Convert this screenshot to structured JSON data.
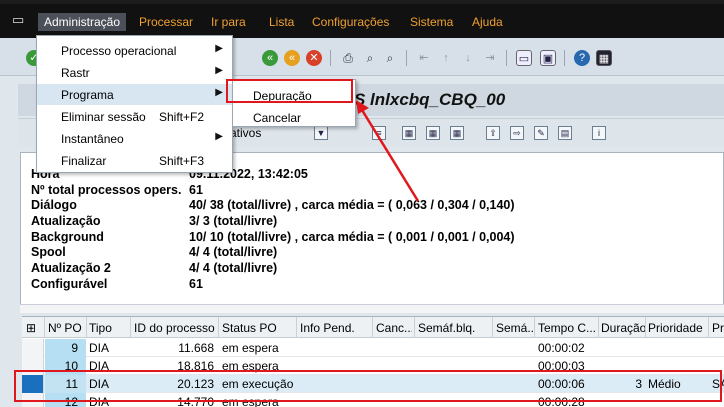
{
  "menubar": {
    "items": [
      "Administração",
      "Processar",
      "Ir para",
      "Lista",
      "Configurações",
      "Sistema",
      "Ajuda"
    ],
    "mnemonics": [
      "A",
      "P",
      "I",
      "L",
      "C",
      "S",
      "A"
    ]
  },
  "dropdown": {
    "items": [
      {
        "label": "Processo operacional",
        "shortcut": "",
        "submenu": true
      },
      {
        "label": "Rastr",
        "shortcut": "",
        "submenu": true
      },
      {
        "label": "Programa",
        "shortcut": "",
        "submenu": true
      },
      {
        "label": "Eliminar sessão",
        "shortcut": "Shift+F2",
        "submenu": false
      },
      {
        "label": "Instantâneo",
        "shortcut": "",
        "submenu": true
      },
      {
        "label": "Finalizar",
        "shortcut": "Shift+F3",
        "submenu": false
      }
    ]
  },
  "submenu": {
    "items": [
      "Depuração",
      "Cancelar"
    ]
  },
  "title": "S lnlxcbq_CBQ_00",
  "app_toolbar": {
    "partial_label": "ativos"
  },
  "info": [
    {
      "label": "Hora",
      "value": "09.11.2022, 13:42:05"
    },
    {
      "label": "Nº total processos opers.",
      "value": "61"
    },
    {
      "label": "Diálogo",
      "value": "40/ 38 (total/livre) , carca média = ( 0,063 / 0,304 / 0,140)"
    },
    {
      "label": "Atualização",
      "value": "3/ 3 (total/livre)"
    },
    {
      "label": "Background",
      "value": "10/ 10 (total/livre) , carca média = ( 0,001 / 0,001 / 0,004)"
    },
    {
      "label": "Spool",
      "value": "4/ 4 (total/livre)"
    },
    {
      "label": "Atualização 2",
      "value": "4/ 4 (total/livre)"
    },
    {
      "label": "Configurável",
      "value": "61"
    }
  ],
  "grid": {
    "columns": [
      "Nº PO",
      "Tipo",
      "ID do processo",
      "Status PO",
      "Info Pend.",
      "Canc...",
      "Semáf.blq.",
      "Semá...",
      "Tempo C...",
      "Duração",
      "Prioridade",
      "Pr"
    ],
    "rows": [
      [
        "9",
        "DIA",
        "11.668",
        "em espera",
        "",
        "",
        "",
        "",
        "00:00:02",
        "",
        "",
        ""
      ],
      [
        "10",
        "DIA",
        "18.816",
        "em espera",
        "",
        "",
        "",
        "",
        "00:00:03",
        "",
        "",
        ""
      ],
      [
        "11",
        "DIA",
        "20.123",
        "em execução",
        "",
        "",
        "",
        "",
        "00:00:06",
        "3",
        "Médio",
        "SA"
      ],
      [
        "12",
        "DIA",
        "14.770",
        "em espera",
        "",
        "",
        "",
        "",
        "00:00:28",
        "",
        "",
        ""
      ]
    ]
  },
  "colors": {
    "accent_menu": "#f0a030",
    "annotation": "#e0181e",
    "selection": "#1a6fbf"
  },
  "icons": [
    "system-menu-icon",
    "check-icon",
    "back-icon",
    "exit-icon",
    "cancel-icon",
    "print-icon",
    "find-icon",
    "find-next-icon",
    "first-page-icon",
    "prev-page-icon",
    "next-page-icon",
    "last-page-icon",
    "new-session-icon",
    "shortcut-icon",
    "help-icon",
    "layout-icon"
  ]
}
